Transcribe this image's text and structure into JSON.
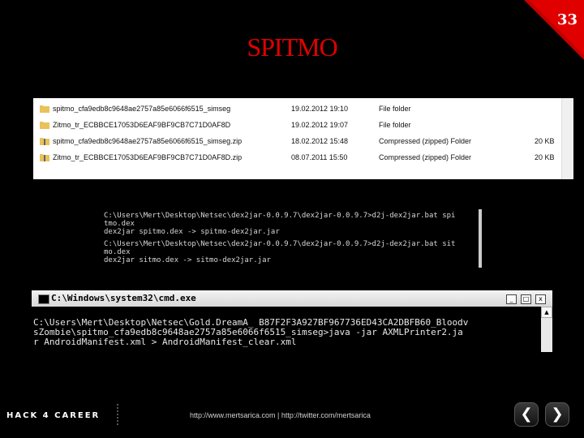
{
  "slide": {
    "page_number": "33",
    "title": "SPITMO"
  },
  "explorer": {
    "files": [
      {
        "name": "spitmo_cfa9edb8c9648ae2757a85e6066f6515_simseg",
        "date": "19.02.2012 19:10",
        "type": "File folder",
        "size": ""
      },
      {
        "name": "Zitmo_tr_ECBBCE17053D6EAF9BF9CB7C71D0AF8D",
        "date": "19.02.2012 19:07",
        "type": "File folder",
        "size": ""
      },
      {
        "name": "spitmo_cfa9edb8c9648ae2757a85e6066f6515_simseg.zip",
        "date": "18.02.2012 15:48",
        "type": "Compressed (zipped) Folder",
        "size": "20 KB"
      },
      {
        "name": "Zitmo_tr_ECBBCE17053D6EAF9BF9CB7C71D0AF8D.zip",
        "date": "08.07.2011 15:50",
        "type": "Compressed (zipped) Folder",
        "size": "20 KB"
      }
    ]
  },
  "console1": {
    "lines": [
      "C:\\Users\\Mert\\Desktop\\Netsec\\dex2jar-0.0.9.7\\dex2jar-0.0.9.7>d2j-dex2jar.bat spi",
      "tmo.dex",
      "dex2jar spitmo.dex -> spitmo-dex2jar.jar",
      "",
      "C:\\Users\\Mert\\Desktop\\Netsec\\dex2jar-0.0.9.7\\dex2jar-0.0.9.7>d2j-dex2jar.bat sit",
      "mo.dex",
      "dex2jar sitmo.dex -> sitmo-dex2jar.jar"
    ]
  },
  "cmd": {
    "title": "C:\\Windows\\system32\\cmd.exe",
    "lines": [
      "",
      "C:\\Users\\Mert\\Desktop\\Netsec\\Gold.DreamA_ B87F2F3A927BF967736ED43CA2DBFB60_Bloodv",
      "sZombie\\spitmo_cfa9edb8c9648ae2757a85e6066f6515_simseg>java -jar AXMLPrinter2.ja",
      "r AndroidManifest.xml > AndroidManifest_clear.xml"
    ],
    "minimize": "_",
    "maximize": "□",
    "close": "x"
  },
  "footer": {
    "logo": "HACK 4 CAREER",
    "link": "http://www.mertsarica.com | http://twitter.com/mertsarica",
    "prev": "❮",
    "next": "❯"
  },
  "colors": {
    "accent_red": "#e00000",
    "background": "#000000"
  },
  "icons": [
    "folder-icon",
    "zip-folder-icon",
    "cmd-icon",
    "prev-arrow-icon",
    "next-arrow-icon"
  ]
}
